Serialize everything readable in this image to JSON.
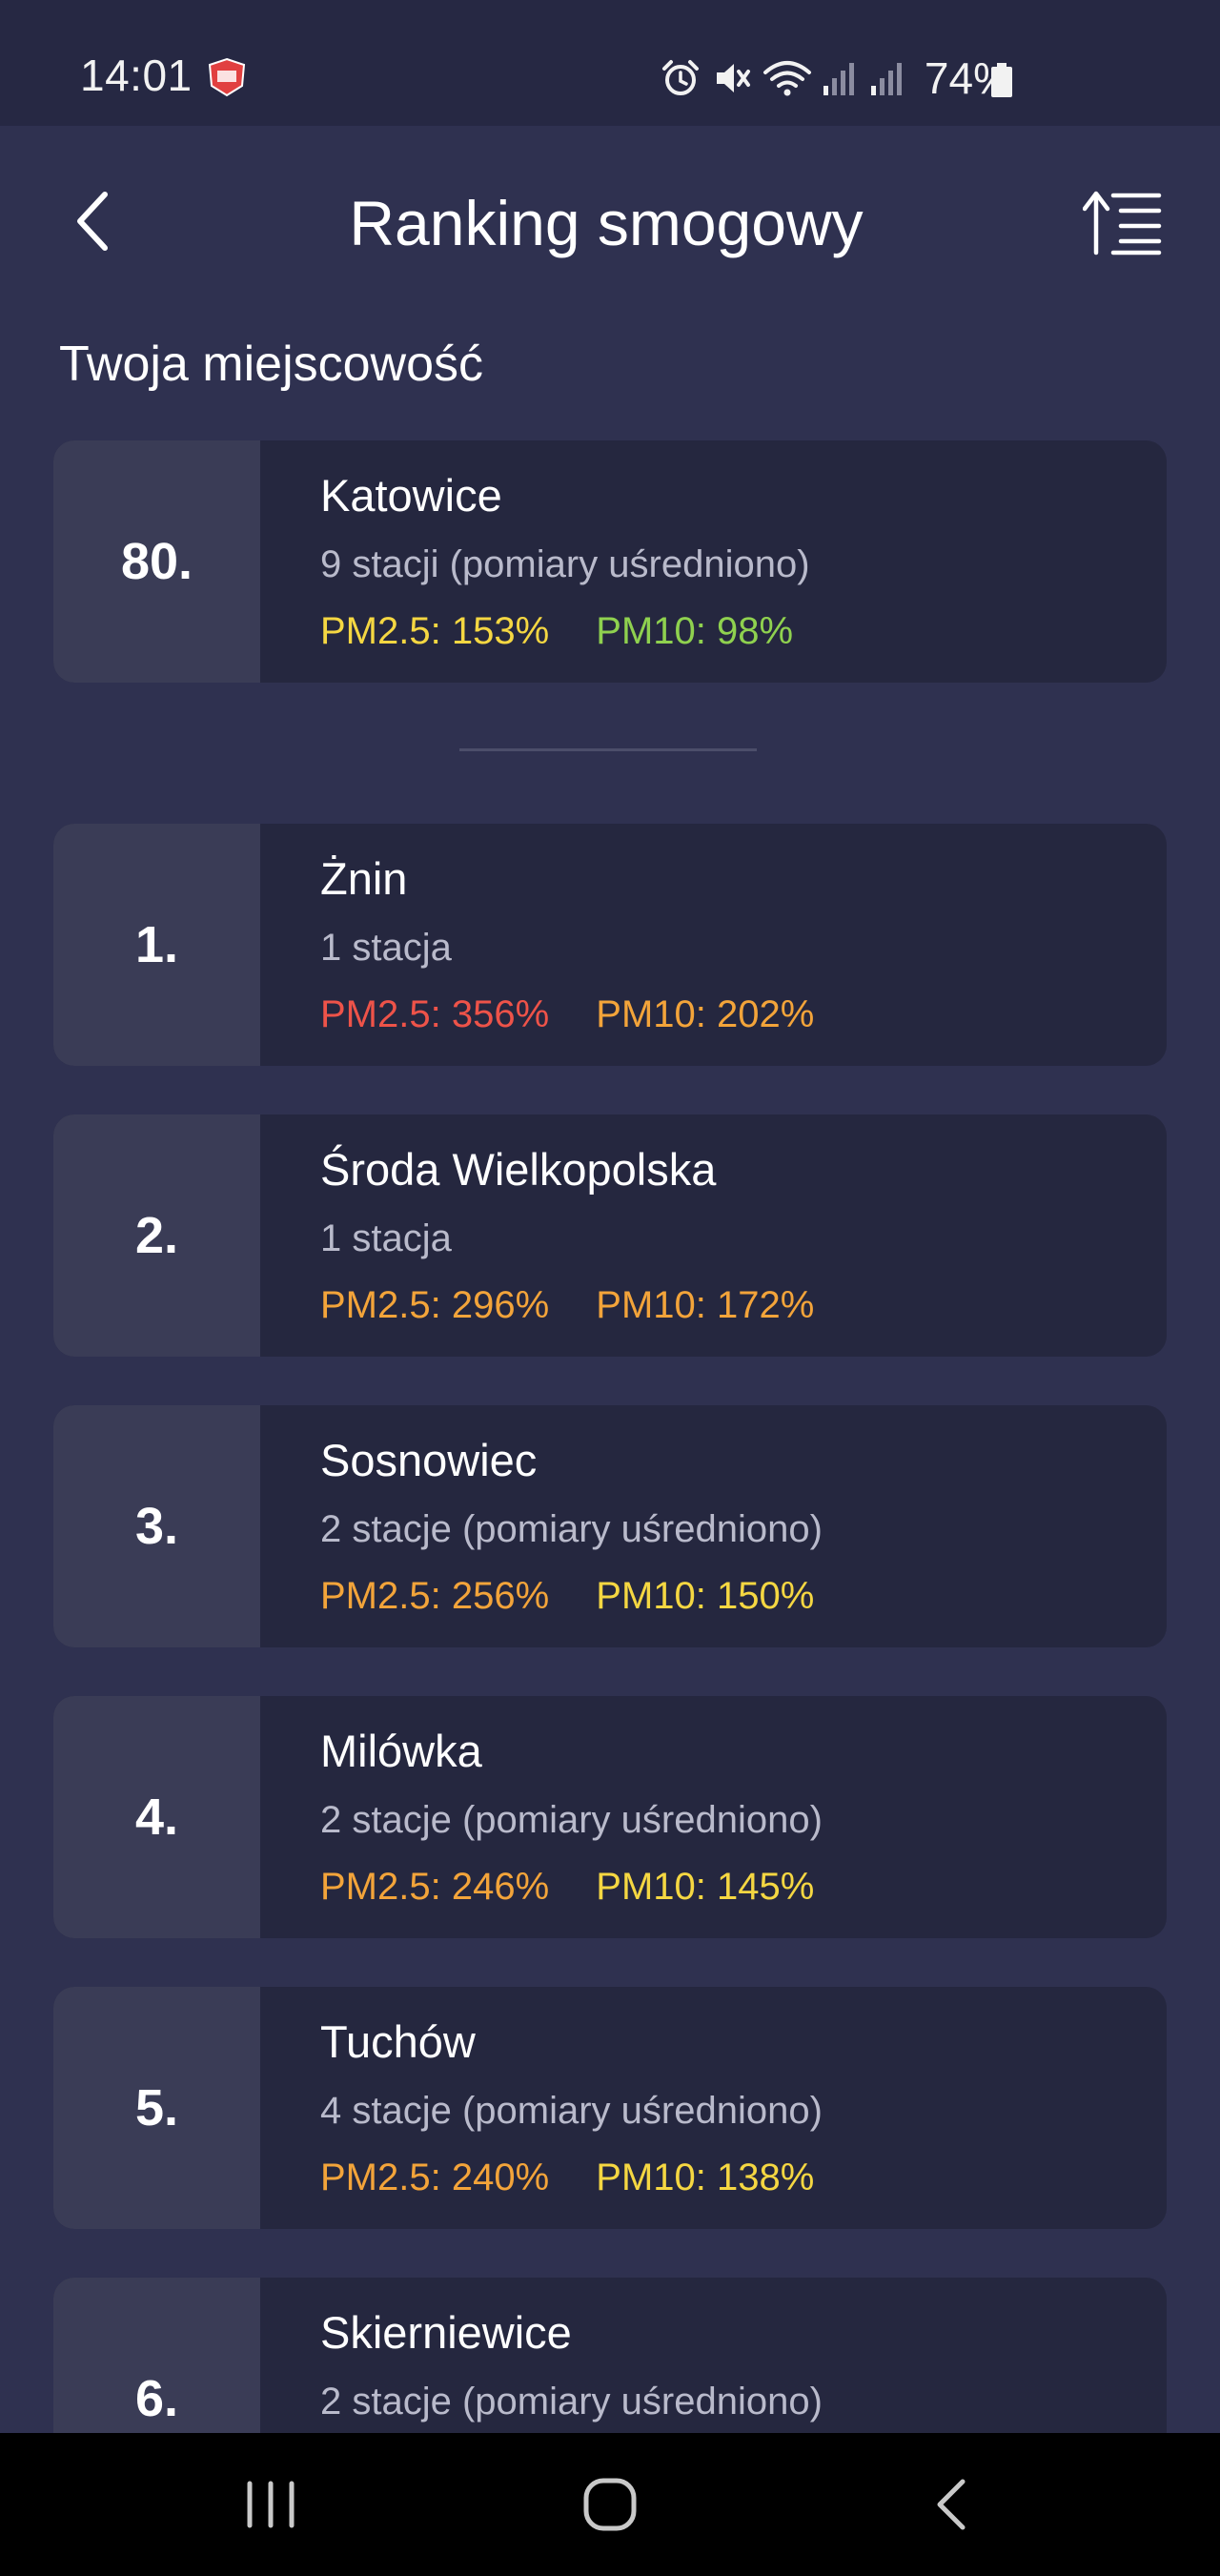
{
  "status_bar": {
    "time": "14:01",
    "battery_percent": "74%",
    "icons": [
      "alarm-icon",
      "mute-icon",
      "wifi-icon",
      "signal-icon",
      "signal-icon-2",
      "battery-icon"
    ]
  },
  "header": {
    "title": "Ranking smogowy",
    "back_icon": "chevron-left-icon",
    "sort_icon": "sort-list-icon"
  },
  "my_location": {
    "section_label": "Twoja miejscowość",
    "rank": "80.",
    "city": "Katowice",
    "stations": "9 stacji (pomiary uśredniono)",
    "pm25": "PM2.5: 153%",
    "pm10": "PM10: 98%",
    "pm25_color": "#f5d742",
    "pm10_color": "#8fd14f"
  },
  "ranking": [
    {
      "rank": "1.",
      "city": "Żnin",
      "stations": "1 stacja",
      "pm25": "PM2.5: 356%",
      "pm10": "PM10: 202%",
      "pm25_color": "#ee5349",
      "pm10_color": "#f3a43a"
    },
    {
      "rank": "2.",
      "city": "Środa Wielkopolska",
      "stations": "1 stacja",
      "pm25": "PM2.5: 296%",
      "pm10": "PM10: 172%",
      "pm25_color": "#f3a43a",
      "pm10_color": "#f3a43a"
    },
    {
      "rank": "3.",
      "city": "Sosnowiec",
      "stations": "2 stacje (pomiary uśredniono)",
      "pm25": "PM2.5: 256%",
      "pm10": "PM10: 150%",
      "pm25_color": "#f3a43a",
      "pm10_color": "#f5d742"
    },
    {
      "rank": "4.",
      "city": "Milówka",
      "stations": "2 stacje (pomiary uśredniono)",
      "pm25": "PM2.5: 246%",
      "pm10": "PM10: 145%",
      "pm25_color": "#f3a43a",
      "pm10_color": "#f5d742"
    },
    {
      "rank": "5.",
      "city": "Tuchów",
      "stations": "4 stacje (pomiary uśredniono)",
      "pm25": "PM2.5: 240%",
      "pm10": "PM10: 138%",
      "pm25_color": "#f3a43a",
      "pm10_color": "#f5d742"
    },
    {
      "rank": "6.",
      "city": "Skierniewice",
      "stations": "2 stacje (pomiary uśredniono)",
      "pm25": "",
      "pm10": "",
      "pm25_color": "#f3a43a",
      "pm10_color": "#f5d742"
    }
  ],
  "nav_bar": {
    "icons": [
      "recent-apps-icon",
      "home-icon",
      "back-nav-icon"
    ]
  }
}
